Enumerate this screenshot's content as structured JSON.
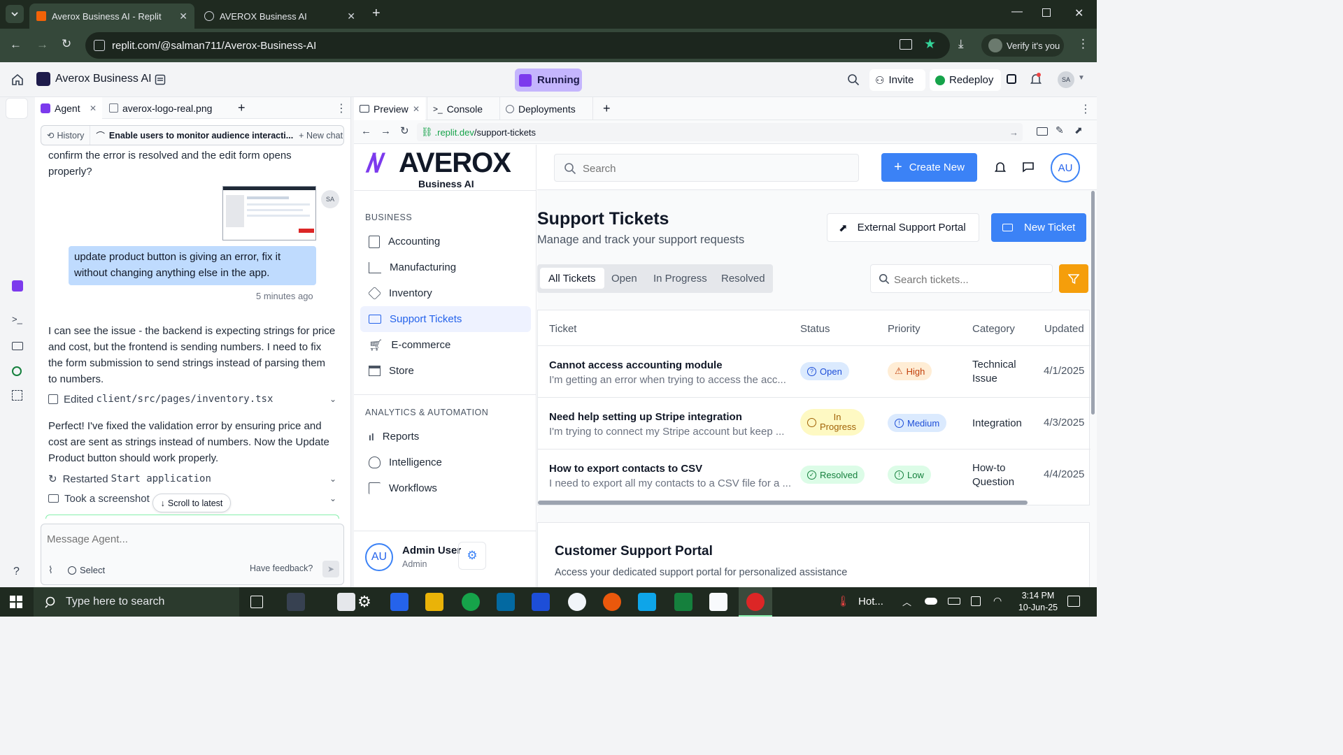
{
  "browser": {
    "tabs": [
      {
        "title": "Averox Business AI - Replit",
        "active": true
      },
      {
        "title": "AVEROX Business AI",
        "active": false
      }
    ],
    "url": "replit.com/@salman711/Averox-Business-AI",
    "verify_label": "Verify it's you"
  },
  "replit": {
    "project_name": "Averox Business AI",
    "run_status": "Running",
    "invite_label": "Invite",
    "redeploy_label": "Redeploy",
    "avatar": "SA"
  },
  "agent_panel": {
    "tabs": [
      "Agent",
      "averox-logo-real.png"
    ],
    "history_label": "History",
    "thread_title": "Enable users to monitor audience interacti...",
    "new_chat_label": "New chat",
    "messages": {
      "top_text": "confirm the error is resolved and the edit form opens properly?",
      "user_avatar": "SA",
      "user_message": "update product button is giving an error, fix it without changing anything else in the app.",
      "user_time": "5 minutes ago",
      "agent_reply_1": "I can see the issue - the backend is expecting strings for price and cost, but the frontend is sending numbers. I need to fix the form submission to send strings instead of parsing them to numbers.",
      "edited_label": "Edited",
      "edited_file": "client/src/pages/inventory.tsx",
      "agent_reply_2": "Perfect! I've fixed the validation error by ensuring price and cost are sent as strings instead of numbers. Now the Update Product button should work properly.",
      "restarted_label": "Restarted",
      "restarted_target": "Start application",
      "screenshot_label": "Took a screenshot"
    },
    "scroll_latest": "Scroll to latest",
    "input_placeholder": "Message Agent...",
    "select_label": "Select",
    "feedback_label": "Have feedback?"
  },
  "preview_panel": {
    "tabs": [
      "Preview",
      "Console",
      "Deployments"
    ],
    "url_domain": ".replit.dev",
    "url_path": "/support-tickets"
  },
  "app": {
    "brand": "AVEROX",
    "brand_sub": "Business AI",
    "search_placeholder": "Search",
    "create_new_label": "Create New",
    "user_initials": "AU",
    "nav": {
      "section_business": "BUSINESS",
      "business_items": [
        "Accounting",
        "Manufacturing",
        "Inventory",
        "Support Tickets",
        "E-commerce",
        "Store"
      ],
      "section_analytics": "ANALYTICS & AUTOMATION",
      "analytics_items": [
        "Reports",
        "Intelligence",
        "Workflows"
      ]
    },
    "user": {
      "name": "Admin User",
      "role": "Admin",
      "initials": "AU"
    },
    "page_title": "Support Tickets",
    "page_subtitle": "Manage and track your support requests",
    "external_portal_label": "External Support Portal",
    "new_ticket_label": "New Ticket",
    "filter_tabs": [
      "All Tickets",
      "Open",
      "In Progress",
      "Resolved"
    ],
    "ticket_search_placeholder": "Search tickets...",
    "columns": [
      "Ticket",
      "Status",
      "Priority",
      "Category",
      "Updated"
    ],
    "tickets": [
      {
        "title": "Cannot access accounting module",
        "desc": "I'm getting an error when trying to access the acc...",
        "status": "Open",
        "priority": "High",
        "category": "Technical Issue",
        "updated": "4/1/2025"
      },
      {
        "title": "Need help setting up Stripe integration",
        "desc": "I'm trying to connect my Stripe account but keep ...",
        "status": "In Progress",
        "priority": "Medium",
        "category": "Integration",
        "updated": "4/3/2025"
      },
      {
        "title": "How to export contacts to CSV",
        "desc": "I need to export all my contacts to a CSV file for a ...",
        "status": "Resolved",
        "priority": "Low",
        "category": "How-to Question",
        "updated": "4/4/2025"
      }
    ],
    "portal_title": "Customer Support Portal",
    "portal_subtitle": "Access your dedicated support portal for personalized assistance"
  },
  "taskbar": {
    "search_placeholder": "Type here to search",
    "weather": "Hot...",
    "time": "3:14 PM",
    "date": "10-Jun-25"
  },
  "colors": {
    "accent": "#3b82f6",
    "running_bg": "#c4b5fd",
    "user_bubble": "#bfdbfe",
    "filter_button": "#f59e0b"
  }
}
